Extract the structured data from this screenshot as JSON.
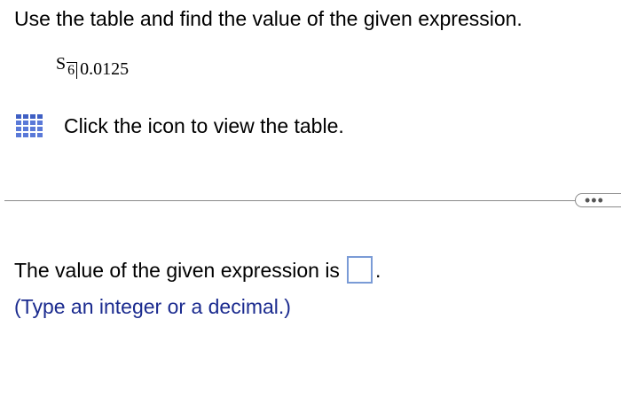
{
  "question": {
    "text": "Use the table and find the value of the given expression."
  },
  "expression": {
    "symbol": "S",
    "n": "6",
    "rate": "0.0125"
  },
  "table_link": {
    "icon": "table-icon",
    "label": "Click the icon to view the table."
  },
  "more_button": {
    "icon": "ellipsis-icon",
    "label": "•••"
  },
  "answer": {
    "prefix": "The value of the given expression is",
    "suffix": ".",
    "value": ""
  },
  "hint": {
    "text": "(Type an integer or a decimal.)"
  },
  "colors": {
    "icon_blue": "#5a79d8",
    "hint_blue": "#1b2b8f",
    "input_border": "#7a9bd6"
  }
}
